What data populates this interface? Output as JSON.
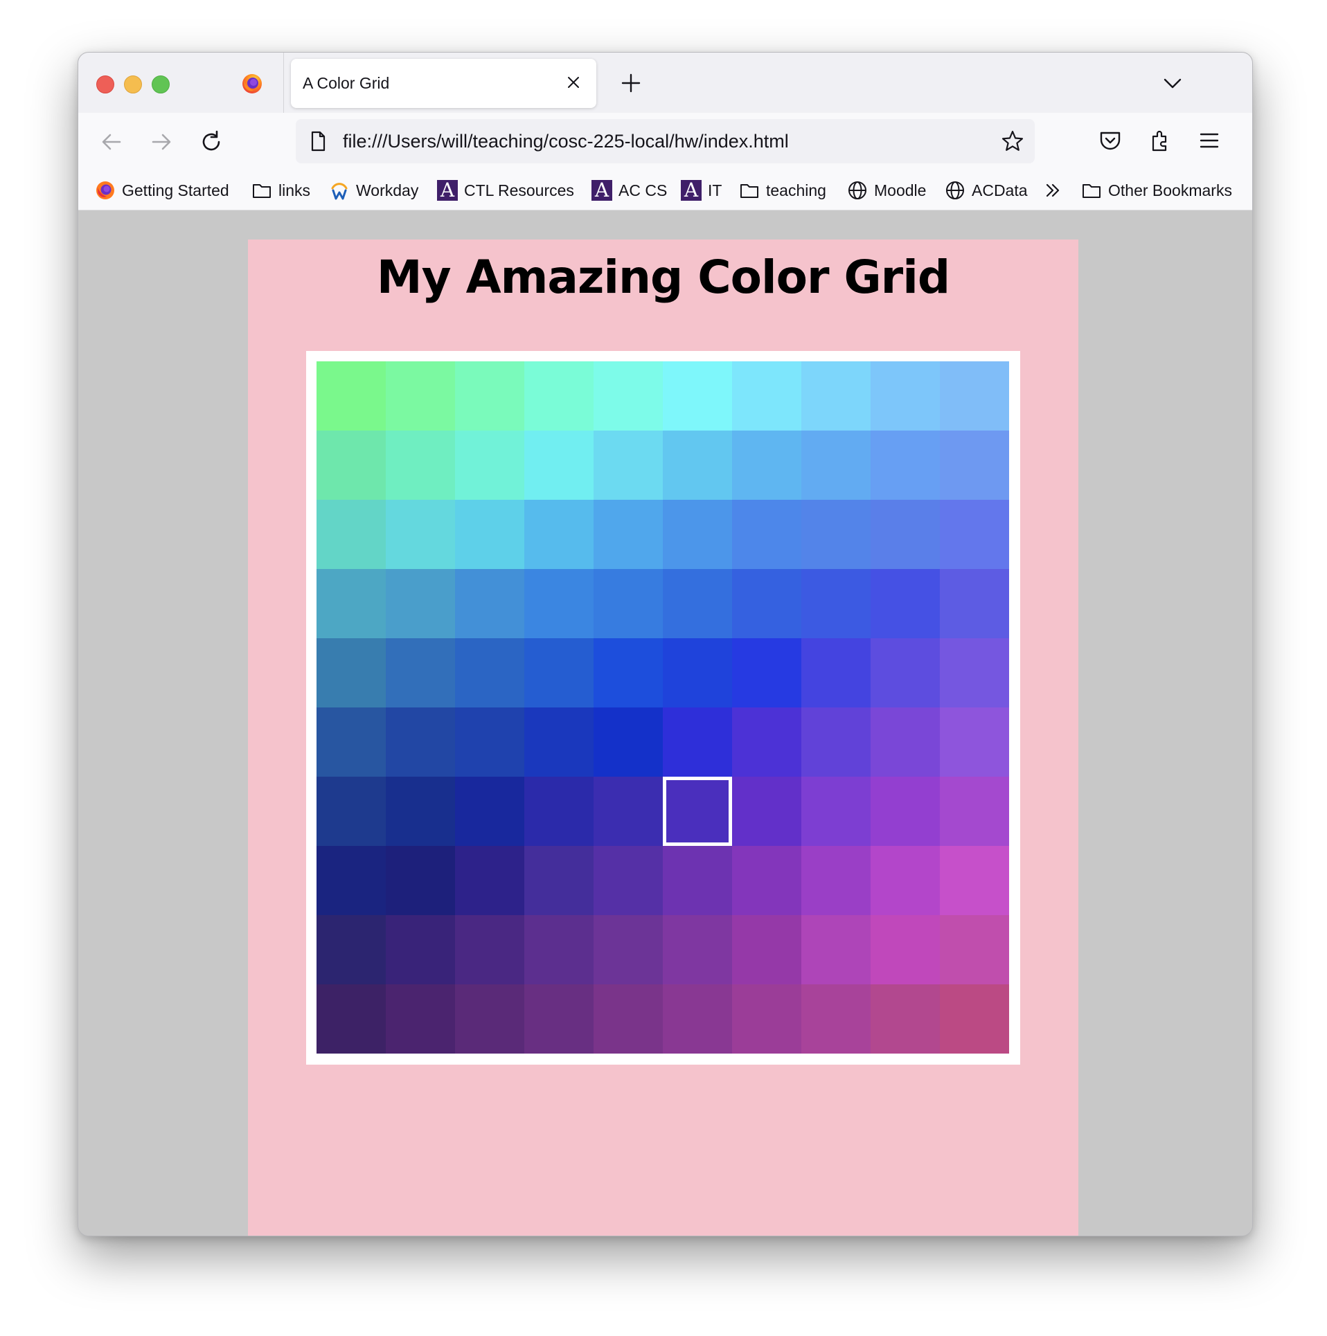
{
  "browser": {
    "tab": {
      "title": "A Color Grid"
    },
    "address_bar": {
      "url": "file:///Users/will/teaching/cosc-225-local/hw/index.html"
    },
    "bookmarks": [
      {
        "label": "Getting Started",
        "icon": "firefox-icon"
      },
      {
        "label": "links",
        "icon": "folder-icon"
      },
      {
        "label": "Workday",
        "icon": "workday-icon"
      },
      {
        "label": "CTL Resources",
        "icon": "amherst-a-icon"
      },
      {
        "label": "AC CS",
        "icon": "amherst-a-icon"
      },
      {
        "label": "IT",
        "icon": "amherst-a-icon"
      },
      {
        "label": "teaching",
        "icon": "folder-icon"
      },
      {
        "label": "Moodle",
        "icon": "globe-icon"
      },
      {
        "label": "ACData",
        "icon": "globe-icon"
      }
    ],
    "other_bookmarks": {
      "label": "Other Bookmarks",
      "icon": "folder-icon"
    }
  },
  "page": {
    "title": "My Amazing Color Grid",
    "background_color": "#c8c8c8",
    "card_color": "#f5c3cc",
    "selected_cell": {
      "row": 6,
      "col": 5
    },
    "grid": [
      [
        "#7af88c",
        "#7bf9a1",
        "#7afabb",
        "#7afcd7",
        "#7dfbe9",
        "#7ef7fb",
        "#7de6fc",
        "#7dd6fb",
        "#7dc6fa",
        "#80bdf8"
      ],
      [
        "#6ee7ac",
        "#6feec1",
        "#71f2d8",
        "#71eef1",
        "#6cdaf1",
        "#62c7f0",
        "#5fb6f1",
        "#62abf2",
        "#679ff3",
        "#6e99f1"
      ],
      [
        "#63d5c7",
        "#64d8de",
        "#5ed0e9",
        "#56bbed",
        "#50a7ec",
        "#4c96ea",
        "#4d87ea",
        "#5384e9",
        "#5a7fe9",
        "#6377ec"
      ],
      [
        "#4da7c4",
        "#4a9ecb",
        "#4390d7",
        "#3b86e1",
        "#377ce0",
        "#346fde",
        "#3561e0",
        "#3c5ae2",
        "#4551e4",
        "#5d5ce3"
      ],
      [
        "#387daf",
        "#326fba",
        "#2b65c4",
        "#255dd1",
        "#1d4edc",
        "#1f43db",
        "#263ae2",
        "#4444e0",
        "#5d4ddf",
        "#7557e0"
      ],
      [
        "#2856a1",
        "#2247a4",
        "#1f42ae",
        "#1a38bd",
        "#1431c9",
        "#2e2fd9",
        "#4c32d6",
        "#6142d8",
        "#7a47d7",
        "#8e55dc"
      ],
      [
        "#1e3a8e",
        "#182f8e",
        "#18289d",
        "#2b2aaa",
        "#3b2db0",
        "#4a2fbd",
        "#6230c9",
        "#7d3ed2",
        "#933fd0",
        "#a449cf"
      ],
      [
        "#1a2480",
        "#1d207b",
        "#2d228a",
        "#442e9b",
        "#5530a6",
        "#6d33b1",
        "#8336bb",
        "#9a3fc6",
        "#b346ca",
        "#c650ca"
      ],
      [
        "#2c2570",
        "#392379",
        "#4a2883",
        "#5c2f8f",
        "#6c3497",
        "#7f37a1",
        "#9539a8",
        "#ae45b8",
        "#c048bb",
        "#c04ead"
      ],
      [
        "#3d2266",
        "#4b246f",
        "#5a2a78",
        "#682f82",
        "#7a348a",
        "#893893",
        "#9b3d98",
        "#a8439a",
        "#b2488f",
        "#bb4a84"
      ]
    ]
  }
}
